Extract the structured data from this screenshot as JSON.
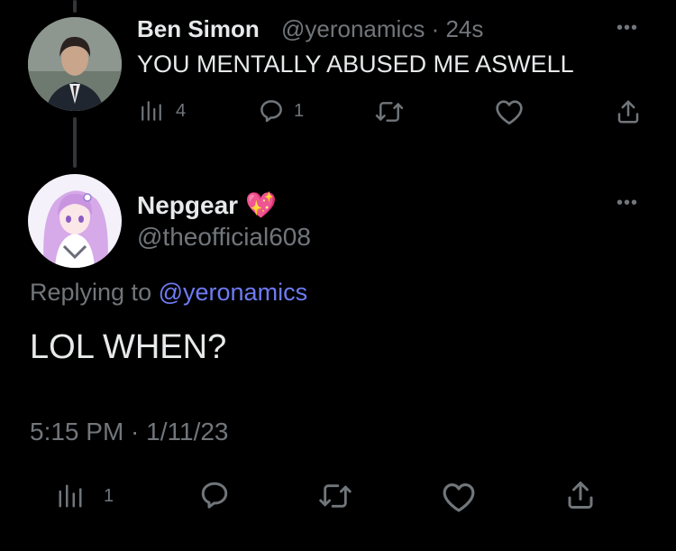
{
  "reply_tweet": {
    "author_name": "Ben Simon",
    "handle": "@yeronamics",
    "separator": "·",
    "time_ago": "24s",
    "text": "YOU MENTALLY ABUSED ME ASWELL",
    "views_count": "4",
    "replies_count": "1"
  },
  "main_tweet": {
    "author_name": "Nepgear",
    "name_emoji": "💖",
    "handle": "@theofficial608",
    "replying_prefix": "Replying to",
    "replying_handle": "@yeronamics",
    "text": "LOL WHEN?",
    "timestamp": "5:15 PM · 1/11/23",
    "views_count": "1"
  },
  "icons": {
    "more": "more-icon",
    "views": "views-icon",
    "reply": "reply-icon",
    "retweet": "retweet-icon",
    "like": "like-icon",
    "share": "share-icon"
  },
  "colors": {
    "background": "#000000",
    "text": "#e7e9ea",
    "muted": "#71767b",
    "link": "#6e7bf3"
  }
}
